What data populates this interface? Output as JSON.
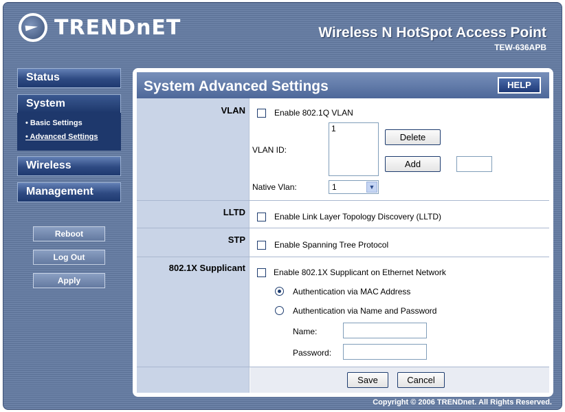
{
  "brand": {
    "logo_text": "TRENDnET",
    "product_title": "Wireless N HotSpot Access Point",
    "model": "TEW-636APB"
  },
  "nav": {
    "status": "Status",
    "system": "System",
    "system_sub": [
      "Basic Settings",
      "Advanced Settings"
    ],
    "wireless": "Wireless",
    "management": "Management"
  },
  "side_buttons": {
    "reboot": "Reboot",
    "logout": "Log Out",
    "apply": "Apply"
  },
  "panel": {
    "title": "System Advanced Settings",
    "help": "HELP"
  },
  "vlan": {
    "label": "VLAN",
    "enable_label": "Enable 802.1Q VLAN",
    "vlan_id_label": "VLAN ID:",
    "list_items": [
      "1"
    ],
    "delete": "Delete",
    "add": "Add",
    "add_value": "",
    "native_label": "Native Vlan:",
    "native_value": "1",
    "enabled": false
  },
  "lltd": {
    "label": "LLTD",
    "enable_label": "Enable Link Layer Topology Discovery (LLTD)",
    "enabled": false
  },
  "stp": {
    "label": "STP",
    "enable_label": "Enable Spanning Tree Protocol",
    "enabled": false
  },
  "supplicant": {
    "label": "802.1X Supplicant",
    "enable_label": "Enable 802.1X Supplicant on Ethernet Network",
    "auth_mac": "Authentication via MAC Address",
    "auth_name": "Authentication via Name and Password",
    "selected_auth": "mac",
    "name_label": "Name:",
    "password_label": "Password:",
    "name_value": "",
    "password_value": "",
    "enabled": false
  },
  "actions": {
    "save": "Save",
    "cancel": "Cancel"
  },
  "footer": "Copyright © 2006 TRENDnet. All Rights Reserved."
}
